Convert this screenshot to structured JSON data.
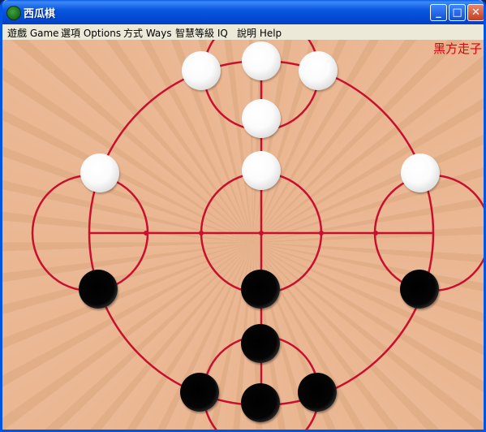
{
  "window": {
    "title": "西瓜棋",
    "buttons": [
      "_",
      "□",
      "✕"
    ]
  },
  "menu": [
    "遊戲 Game",
    "選項 Options",
    "方式 Ways",
    "智慧等級 IQ",
    "說明 Help"
  ],
  "status": "黑方走子",
  "colors": {
    "line": "#c8102e",
    "status": "#e0000a",
    "board": "#e9b48e"
  },
  "pieces": {
    "white": [
      "top-left",
      "top",
      "top-right",
      "upper-center",
      "inner-top",
      "left",
      "right"
    ],
    "black": [
      "left",
      "inner-bottom",
      "right",
      "lower-center",
      "bottom-left",
      "bottom",
      "bottom-right"
    ]
  }
}
